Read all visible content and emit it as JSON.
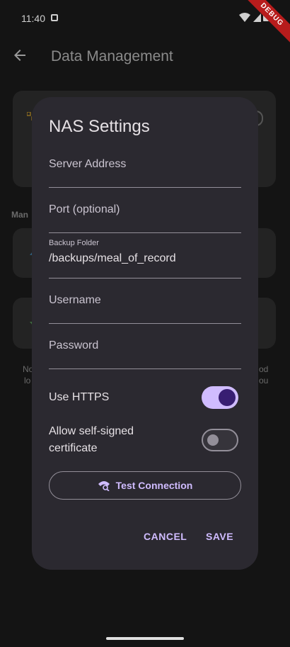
{
  "status_bar": {
    "time": "11:40",
    "debug_banner": "DEBUG"
  },
  "app_bar": {
    "title": "Data Management",
    "back_icon": "arrow-back-icon"
  },
  "background": {
    "section_fragment": "Man",
    "left_text_1": "No",
    "left_text_2": "lo",
    "right_text_1": "od",
    "right_text_2": "ou"
  },
  "dialog": {
    "title": "NAS Settings",
    "fields": {
      "server_address": {
        "label": "Server Address",
        "value": ""
      },
      "port": {
        "label": "Port (optional)",
        "value": ""
      },
      "backup_folder": {
        "label": "Backup Folder",
        "value": "/backups/meal_of_record"
      },
      "username": {
        "label": "Username",
        "value": ""
      },
      "password": {
        "label": "Password",
        "value": ""
      }
    },
    "switches": {
      "use_https": {
        "label": "Use HTTPS",
        "on": true
      },
      "allow_self_signed": {
        "label": "Allow self-signed certificate",
        "on": false
      }
    },
    "test_button": {
      "label": "Test Connection",
      "icon": "network-check-icon"
    },
    "actions": {
      "cancel": "CANCEL",
      "save": "SAVE"
    }
  },
  "colors": {
    "dialog_bg": "#2b2930",
    "accent": "#d0bcff",
    "accent_dark": "#381e72",
    "outline": "#938f99",
    "debug_ribbon": "#b71c1c"
  }
}
